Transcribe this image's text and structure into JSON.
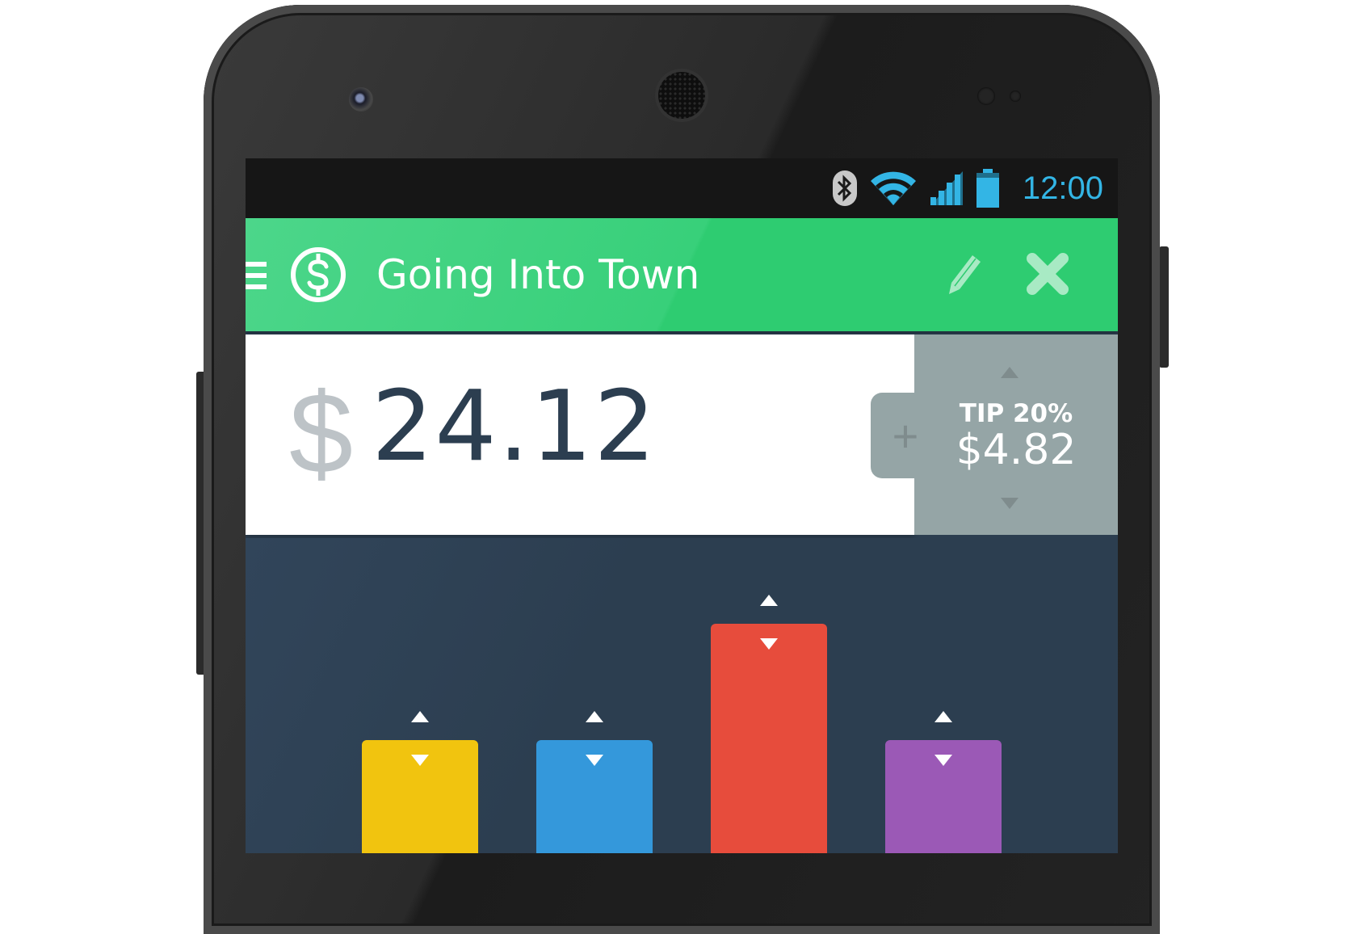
{
  "status_bar": {
    "time": "12:00",
    "icons": [
      "bluetooth-icon",
      "wifi-icon",
      "signal-icon",
      "battery-icon"
    ],
    "accent_color": "#33b5e5"
  },
  "app_bar": {
    "title": "Going Into Town",
    "menu_icon": "hamburger-menu-icon",
    "logo_icon": "dollar-circle-icon",
    "actions": [
      "edit-pencil-icon",
      "close-x-icon"
    ],
    "color": "#2ecc71"
  },
  "bill": {
    "currency_symbol": "$",
    "amount": "24.12"
  },
  "tip": {
    "label": "TIP 20%",
    "amount": "$4.82",
    "add_symbol": "+"
  },
  "split_bars": {
    "colors": [
      "#f1c40f",
      "#3498db",
      "#e74c3c",
      "#9b59b6"
    ],
    "relative_levels": [
      1,
      1,
      2,
      1
    ]
  }
}
